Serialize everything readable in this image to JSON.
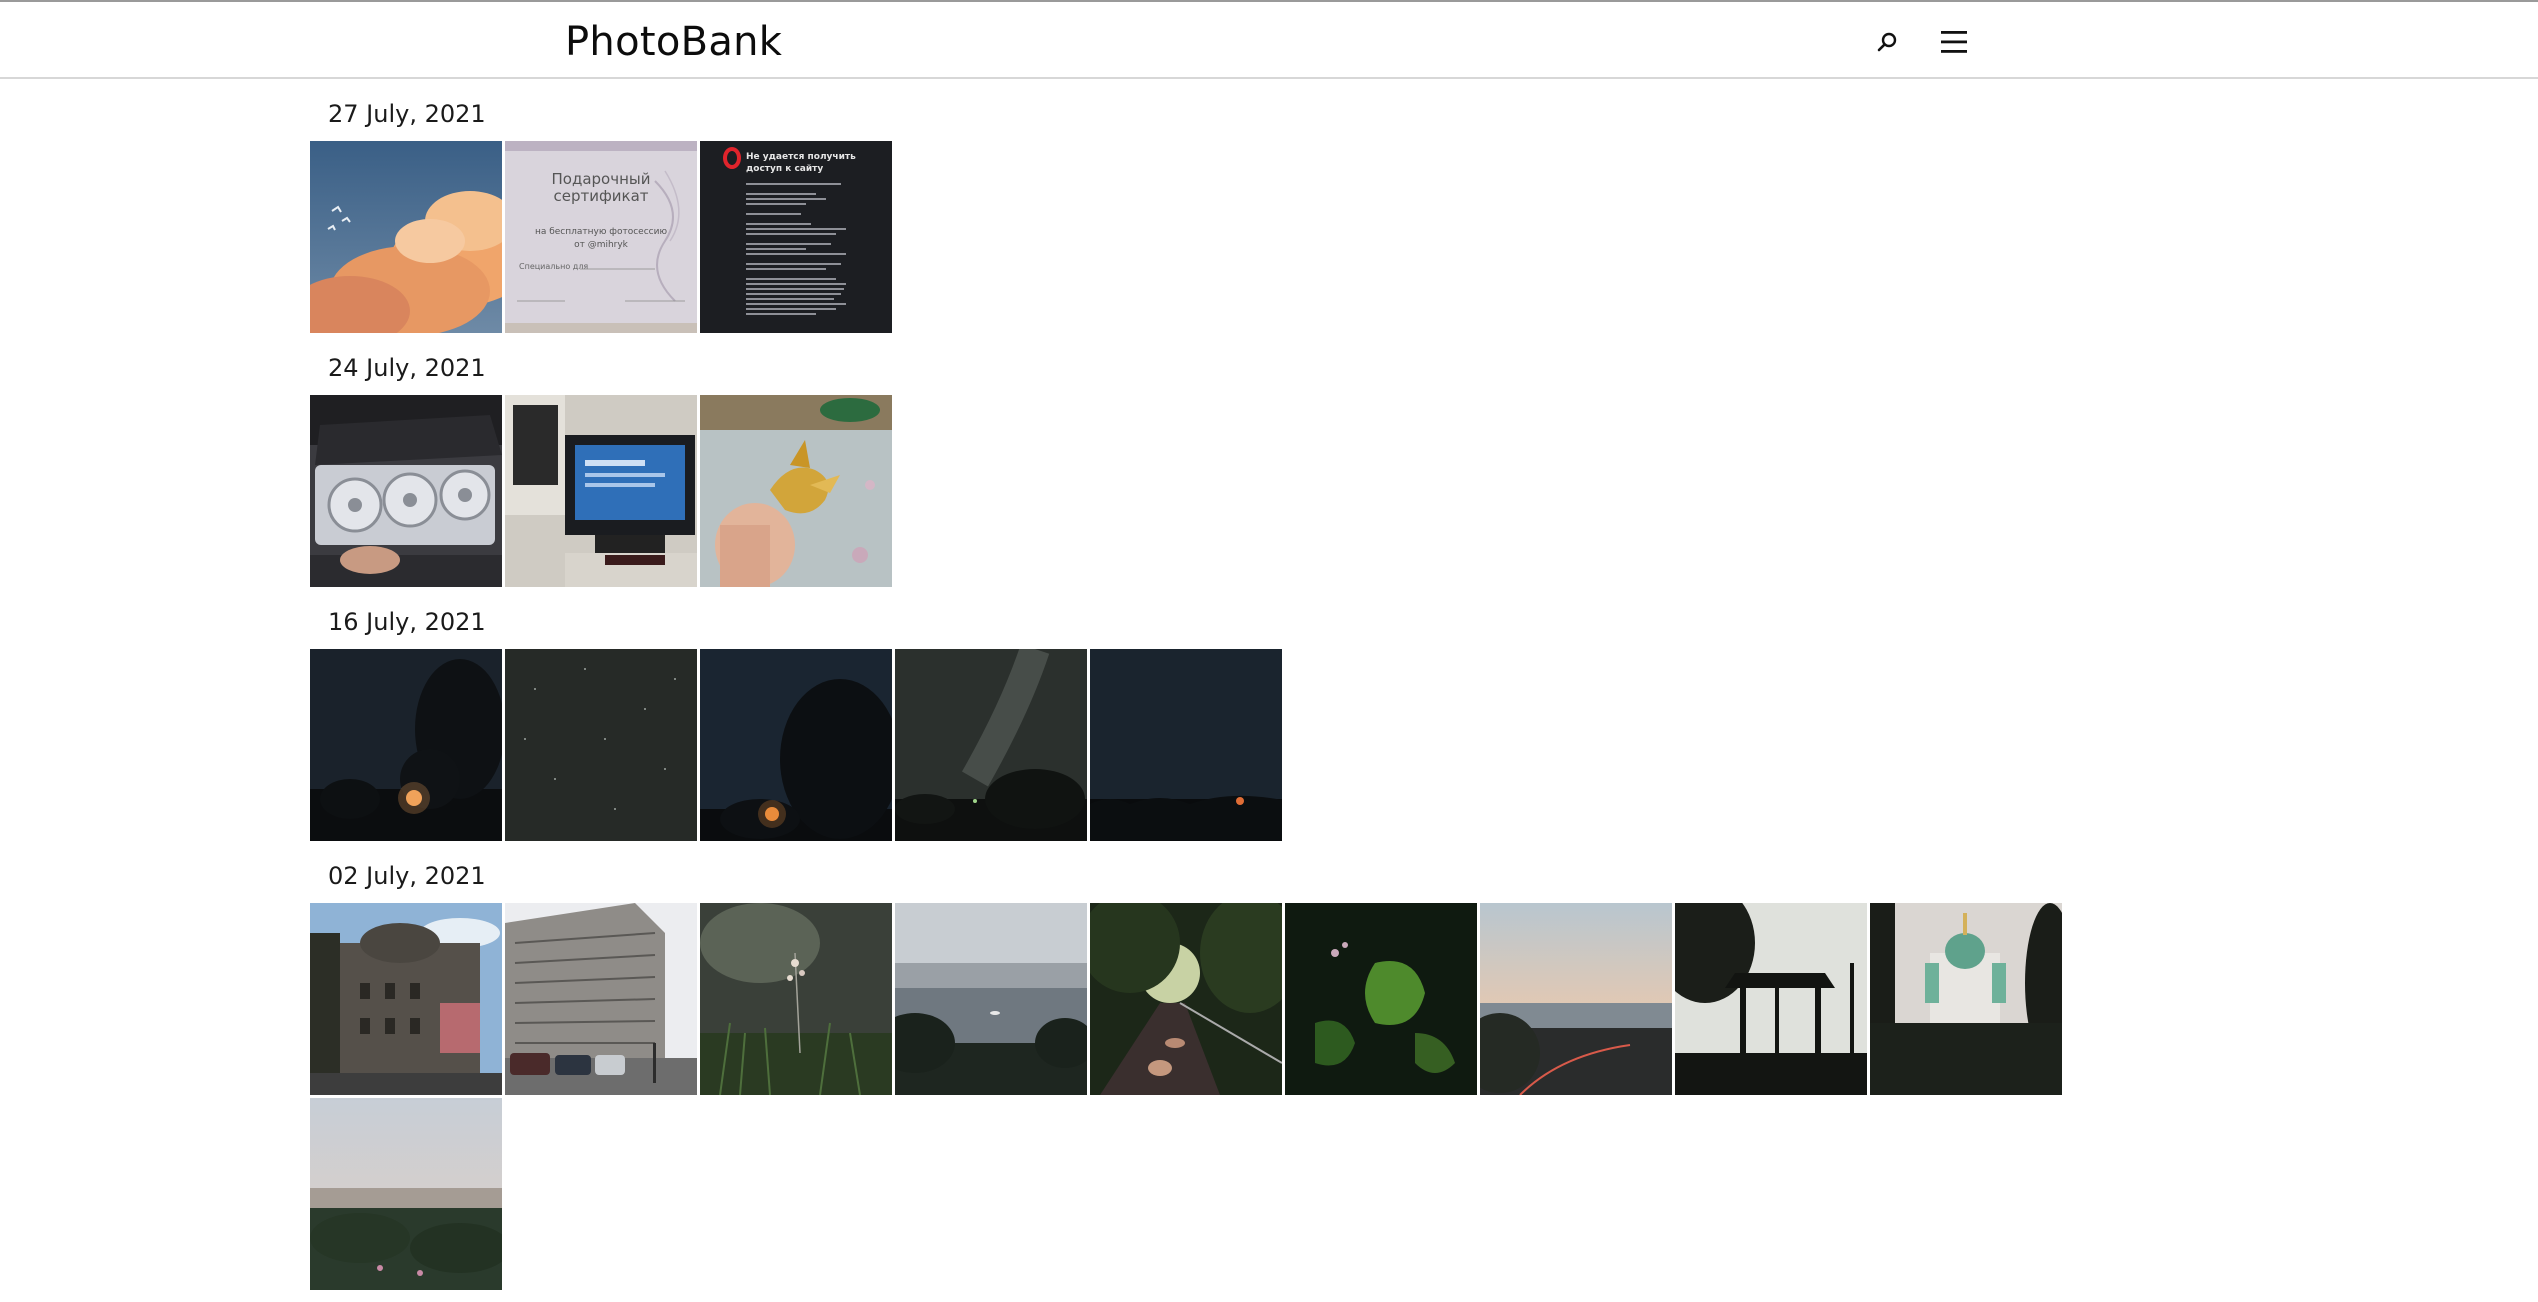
{
  "header": {
    "logo": "PhotoBank",
    "search_icon": "search-icon",
    "menu_icon": "hamburger-menu-icon"
  },
  "groups": [
    {
      "date": "27 July, 2021",
      "photos": [
        {
          "name": "photo-sky-clouds",
          "desc_icon": "image-thumbnail"
        },
        {
          "name": "photo-gift-certificate",
          "desc_icon": "image-thumbnail"
        },
        {
          "name": "photo-opera-error-screenshot",
          "desc_icon": "image-thumbnail"
        }
      ]
    },
    {
      "date": "24 July, 2021",
      "photos": [
        {
          "name": "photo-graphics-card",
          "desc_icon": "image-thumbnail"
        },
        {
          "name": "photo-pc-monitor",
          "desc_icon": "image-thumbnail"
        },
        {
          "name": "photo-golden-figurine",
          "desc_icon": "image-thumbnail"
        }
      ]
    },
    {
      "date": "16 July, 2021",
      "photos": [
        {
          "name": "photo-night-moon-trees",
          "desc_icon": "image-thumbnail"
        },
        {
          "name": "photo-night-sky-stars",
          "desc_icon": "image-thumbnail"
        },
        {
          "name": "photo-night-moon-tree-2",
          "desc_icon": "image-thumbnail"
        },
        {
          "name": "photo-milky-way",
          "desc_icon": "image-thumbnail"
        },
        {
          "name": "photo-night-horizon",
          "desc_icon": "image-thumbnail"
        }
      ]
    },
    {
      "date": "02 July, 2021",
      "photos": [
        {
          "name": "photo-old-building",
          "desc_icon": "image-thumbnail"
        },
        {
          "name": "photo-government-building",
          "desc_icon": "image-thumbnail"
        },
        {
          "name": "photo-wild-flowers",
          "desc_icon": "image-thumbnail"
        },
        {
          "name": "photo-river-view",
          "desc_icon": "image-thumbnail"
        },
        {
          "name": "photo-park-path",
          "desc_icon": "image-thumbnail"
        },
        {
          "name": "photo-green-leaves",
          "desc_icon": "image-thumbnail"
        },
        {
          "name": "photo-city-sunset",
          "desc_icon": "image-thumbnail"
        },
        {
          "name": "photo-gazebo-silhouette",
          "desc_icon": "image-thumbnail"
        },
        {
          "name": "photo-st-andrews-church",
          "desc_icon": "image-thumbnail"
        },
        {
          "name": "photo-city-panorama",
          "desc_icon": "image-thumbnail"
        }
      ]
    }
  ],
  "thumb_text": {
    "cert_title_1": "Подарочный",
    "cert_title_2": "сертификат",
    "cert_line_1": "на бесплатную фотосессию",
    "cert_line_2": "от @mihryk",
    "cert_line_3": "Специально для",
    "opera_title_1": "Не удается получить",
    "opera_title_2": "доступ к сайту"
  }
}
